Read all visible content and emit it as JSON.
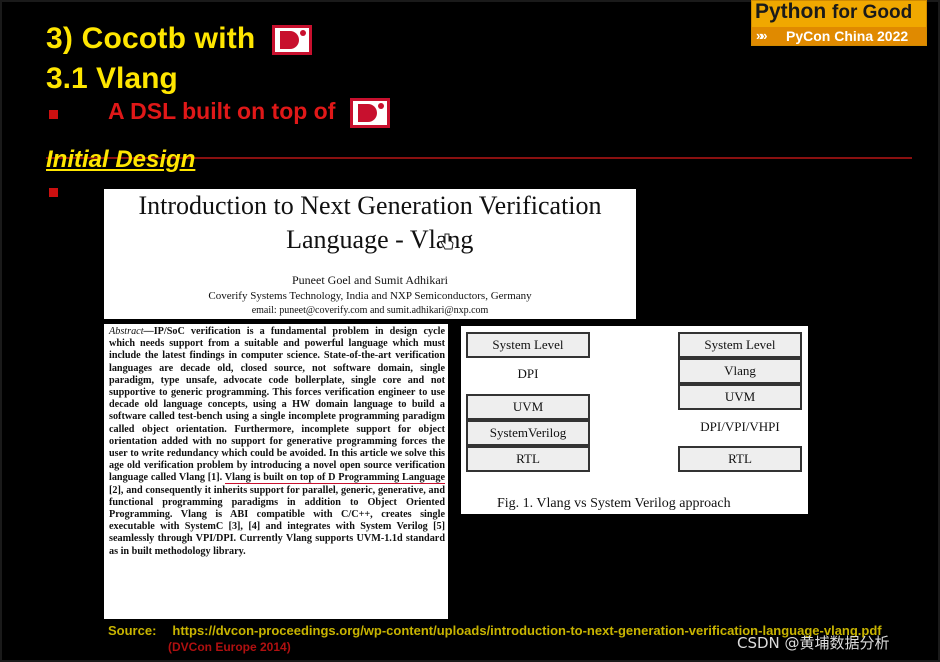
{
  "slide": {
    "heading1": "3)  Cocotb with",
    "heading2": "3.1  Vlang",
    "bullet1": "A DSL built on top of",
    "section": "Initial Design",
    "logo_letter": "D",
    "accent_yellow": "#ffe600",
    "accent_red": "#e01818"
  },
  "badge": {
    "line1_python": "Python",
    "line1_rest": "for Good",
    "arrows": "»»",
    "line2": "PyCon China 2022"
  },
  "paper": {
    "title_line1": "Introduction to Next Generation Verification",
    "title_line2_prefix": "Language - ",
    "title_line2_name": "Vlang",
    "authors": "Puneet Goel and Sumit Adhikari",
    "affiliation": "Coverify Systems Technology, India and NXP Semiconductors, Germany",
    "email": "email: puneet@coverify.com and sumit.adhikari@nxp.com",
    "abstract_label": "Abstract",
    "abstract_pre": "—IP/SoC verification is a fundamental problem in design cycle which needs support from a suitable and powerful language which must include the latest findings in computer science. State-of-the-art verification languages are decade old, closed source, not software domain, single paradigm, type unsafe, advocate code bollerplate, single core and not supportive to generic programming. This forces verification engineer to use decade old language concepts, using a HW domain language to build a software called test-bench using a single incomplete programming paradigm called object orientation. Furthermore, incomplete support for object orientation added with no support for generative programming forces the user to write redundancy which could be avoided. In this article we solve this age old verification problem by introducing a novel open source verification language called Vlang [1]. ",
    "abstract_highlight": "Vlang is built on top of D Programming Language",
    "abstract_post": " [2], and consequently it inherits support for parallel, generic, generative, and functional programming paradigms in addition to Object Oriented Programming. Vlang is ABI compatible with C/C++, creates single executable with SystemC [3], [4] and integrates with System Verilog [5] seamlessly through VPI/DPI. Currently Vlang supports UVM-1.1d standard as in built methodology library."
  },
  "figure": {
    "left_stack": [
      "System Level",
      "DPI",
      "UVM",
      "SystemVerilog",
      "RTL"
    ],
    "right_stack": [
      "System Level",
      "Vlang",
      "UVM",
      "DPI/VPI/VHPI",
      "RTL"
    ],
    "caption": "Fig. 1.   Vlang vs System Verilog approach"
  },
  "footer": {
    "source_label": "Source:",
    "source_url": "https://dvcon-proceedings.org/wp-content/uploads/introduction-to-next-generation-verification-language-vlang.pdf",
    "source_sub": "(DVCon Europe 2014)",
    "watermark": "CSDN @黄埔数据分析"
  }
}
